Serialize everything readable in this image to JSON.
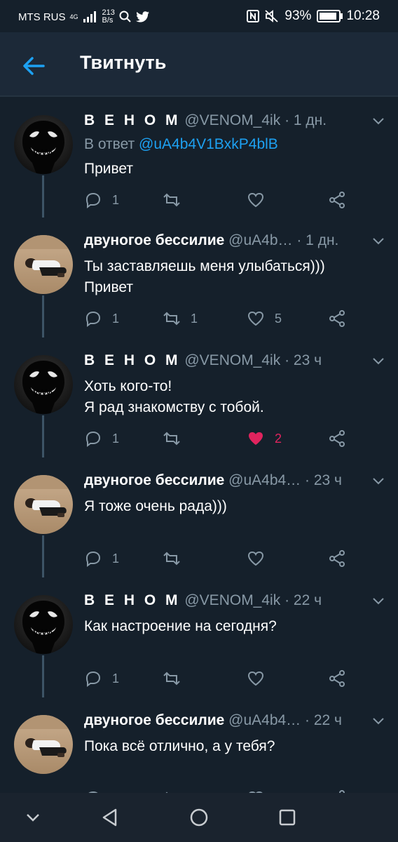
{
  "status_bar": {
    "carrier": "MTS RUS",
    "network": "4G",
    "speed_value": "213",
    "speed_unit": "B/s",
    "battery": "93%",
    "time": "10:28"
  },
  "header": {
    "title": "Твитнуть"
  },
  "tweets": [
    {
      "name": "В Е Н О М",
      "handle": "@VENOM_4ik",
      "time": "· 1 дн.",
      "reply_prefix": "В ответ",
      "reply_mention": "@uA4b4V1BxkP4blB",
      "text": "Привет",
      "replies": "1",
      "retweets": "",
      "likes": ""
    },
    {
      "name": "двуногое бессилие",
      "handle": "@uA4b…",
      "time": "· 1 дн.",
      "text_lines": [
        "Ты заставляешь меня улыбаться)))",
        "Привет"
      ],
      "replies": "1",
      "retweets": "1",
      "likes": "5"
    },
    {
      "name": "В Е Н О М",
      "handle": "@VENOM_4ik",
      "time": "· 23 ч",
      "text_lines": [
        "Хоть кого-то!",
        "Я рад знакомству с тобой."
      ],
      "replies": "1",
      "retweets": "",
      "likes": "2"
    },
    {
      "name": "двуногое бессилие",
      "handle": "@uA4b4…",
      "time": "· 23 ч",
      "text": "Я тоже очень рада)))",
      "replies": "1",
      "retweets": "",
      "likes": ""
    },
    {
      "name": "В Е Н О М",
      "handle": "@VENOM_4ik",
      "time": "· 22 ч",
      "text": "Как настроение на сегодня?",
      "replies": "1",
      "retweets": "",
      "likes": ""
    },
    {
      "name": "двуногое бессилие",
      "handle": "@uA4b4…",
      "time": "· 22 ч",
      "text": "Пока всё отлично, а у тебя?"
    }
  ],
  "colors": {
    "background": "#15202b",
    "header": "#1c2938",
    "accent": "#1da1f2",
    "secondary_text": "#8899a6",
    "like_active": "#e0245e"
  },
  "icons": [
    "back-arrow-icon",
    "chevron-down-icon",
    "reply-icon",
    "retweet-icon",
    "heart-icon",
    "share-icon",
    "nav-back-icon",
    "nav-home-icon",
    "nav-recents-icon",
    "nav-collapse-icon"
  ]
}
